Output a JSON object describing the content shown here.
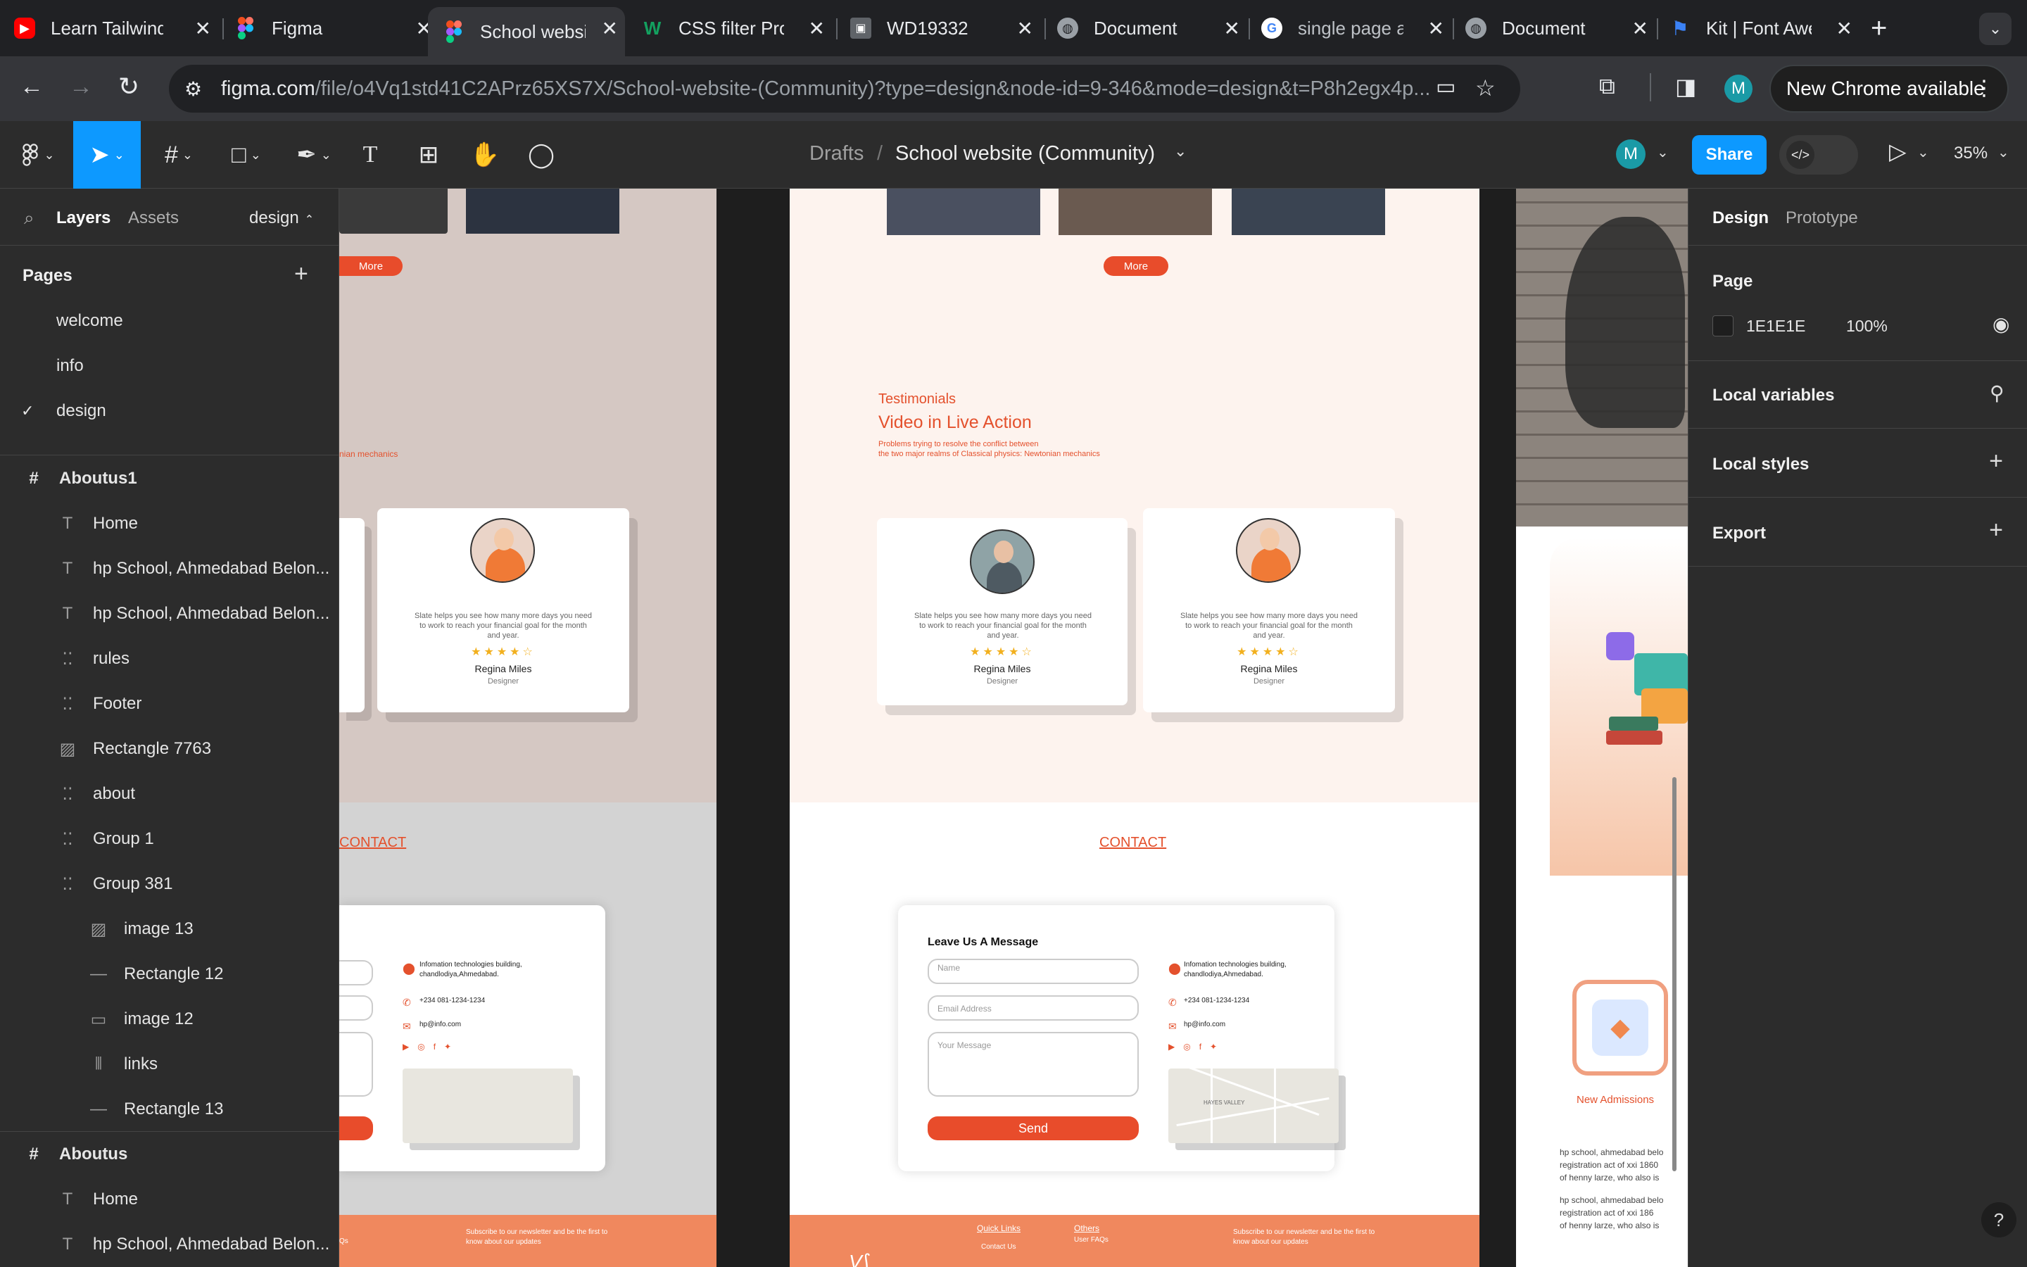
{
  "browser": {
    "tabs": [
      {
        "label": "Learn Tailwind",
        "icon": "youtube-icon",
        "color": "#ff0000"
      },
      {
        "label": "Figma",
        "icon": "figma-icon",
        "color": "#a259ff"
      },
      {
        "label": "School website",
        "icon": "figma-icon",
        "color": "#a259ff",
        "active": true
      },
      {
        "label": "CSS filter Pro",
        "icon": "w-icon",
        "color": "#13a05f"
      },
      {
        "label": "WD19332",
        "icon": "contact-card-icon",
        "color": "#9aa0a6"
      },
      {
        "label": "Document",
        "icon": "globe-icon",
        "color": "#9aa0a6"
      },
      {
        "label": "single page a",
        "icon": "google-icon",
        "color": "#4285f4"
      },
      {
        "label": "Document",
        "icon": "globe-icon",
        "color": "#9aa0a6"
      },
      {
        "label": "Kit | Font Awe",
        "icon": "flag-icon",
        "color": "#3b82f6"
      }
    ],
    "url_host": "figma.com",
    "url_path": "/file/o4Vq1std41C2APrz65XS7X/School-website-(Community)?type=design&node-id=9-346&mode=design&t=P8h2egx4p...",
    "new_chrome_label": "New Chrome available",
    "profile_initial": "M"
  },
  "figma": {
    "breadcrumb_drafts": "Drafts",
    "breadcrumb_sep": "/",
    "file_name": "School website (Community)",
    "share_label": "Share",
    "zoom": "35%",
    "avatar_initial": "M"
  },
  "left_panel": {
    "tab_layers": "Layers",
    "tab_assets": "Assets",
    "page_selector": "design",
    "pages_title": "Pages",
    "pages": [
      {
        "label": "welcome",
        "checked": false
      },
      {
        "label": "info",
        "checked": false
      },
      {
        "label": "design",
        "checked": true
      }
    ],
    "layers": [
      {
        "label": "Aboutus1",
        "icon": "frame-icon",
        "level": 0
      },
      {
        "label": "Home",
        "icon": "text-icon",
        "level": 1
      },
      {
        "label": "hp School, Ahmedabad Belon...",
        "icon": "text-icon",
        "level": 1
      },
      {
        "label": "hp School, Ahmedabad Belon...",
        "icon": "text-icon",
        "level": 1
      },
      {
        "label": "rules",
        "icon": "group-icon",
        "level": 1
      },
      {
        "label": "Footer",
        "icon": "group-icon",
        "level": 1
      },
      {
        "label": "Rectangle 7763",
        "icon": "image-icon",
        "level": 1
      },
      {
        "label": "about",
        "icon": "group-icon",
        "level": 1
      },
      {
        "label": "Group 1",
        "icon": "group-icon",
        "level": 1
      },
      {
        "label": "Group 381",
        "icon": "group-icon",
        "level": 1
      },
      {
        "label": "image 13",
        "icon": "image-icon",
        "level": 2
      },
      {
        "label": "Rectangle 12",
        "icon": "line-icon",
        "level": 2
      },
      {
        "label": "image 12",
        "icon": "rect-icon",
        "level": 2
      },
      {
        "label": "links",
        "icon": "columns-icon",
        "level": 2
      },
      {
        "label": "Rectangle 13",
        "icon": "line-icon",
        "level": 2
      },
      {
        "label": "Aboutus",
        "icon": "frame-icon",
        "level": 0
      },
      {
        "label": "Home",
        "icon": "text-icon",
        "level": 1
      },
      {
        "label": "hp School, Ahmedabad Belon...",
        "icon": "text-icon",
        "level": 1
      }
    ]
  },
  "right_panel": {
    "tab_design": "Design",
    "tab_prototype": "Prototype",
    "page_title": "Page",
    "page_color": "1E1E1E",
    "page_opacity": "100%",
    "local_variables": "Local variables",
    "local_styles": "Local styles",
    "export": "Export",
    "help": "?"
  },
  "canvas": {
    "more_label": "More",
    "testimonials_kicker": "Testimonials",
    "testimonials_title": "Video in Live Action",
    "testimonials_sub1": "Problems trying to resolve the conflict between",
    "testimonials_sub2": "the two major realms of Classical physics: Newtonian mechanics",
    "left_sub_fragment": "nian mechanics",
    "review_text": "Slate helps you see how many more days you need to work to reach your financial goal for the month and year.",
    "stars": "★★★★☆",
    "reviewer_name": "Regina Miles",
    "reviewer_role": "Designer",
    "contact_heading": "CONTACT",
    "left_contact_fragment": "CONTACT",
    "form_title": "Leave Us A Message",
    "name_placeholder": "Name",
    "email_placeholder": "Email Address",
    "message_placeholder": "Your Message",
    "send_label": "Send",
    "address_line1": "Infomation technologies building,",
    "address_line2": "chandlodiya,Ahmedabad.",
    "phone": "+234 081-1234-1234",
    "email": "hp@info.com",
    "map_label": "HAYES VALLEY",
    "subscribe_line1": "Subscribe to our newsletter and be the first to",
    "subscribe_line2": "know about our updates",
    "quick_links": "Quick Links",
    "contact_us": "Contact Us",
    "others": "Others",
    "user_faqs": "User FAQs",
    "left_footer_fragment": "Qs",
    "new_admissions": "New Admissions",
    "about_line1": "hp school, ahmedabad belo",
    "about_line2": "registration act of xxi 1860",
    "about_line3": "of henny larze, who also is",
    "about_line4": "hp school, ahmedabad belo",
    "about_line5": "registration act of xxi 186",
    "about_line6": "of henny larze, who also is"
  }
}
